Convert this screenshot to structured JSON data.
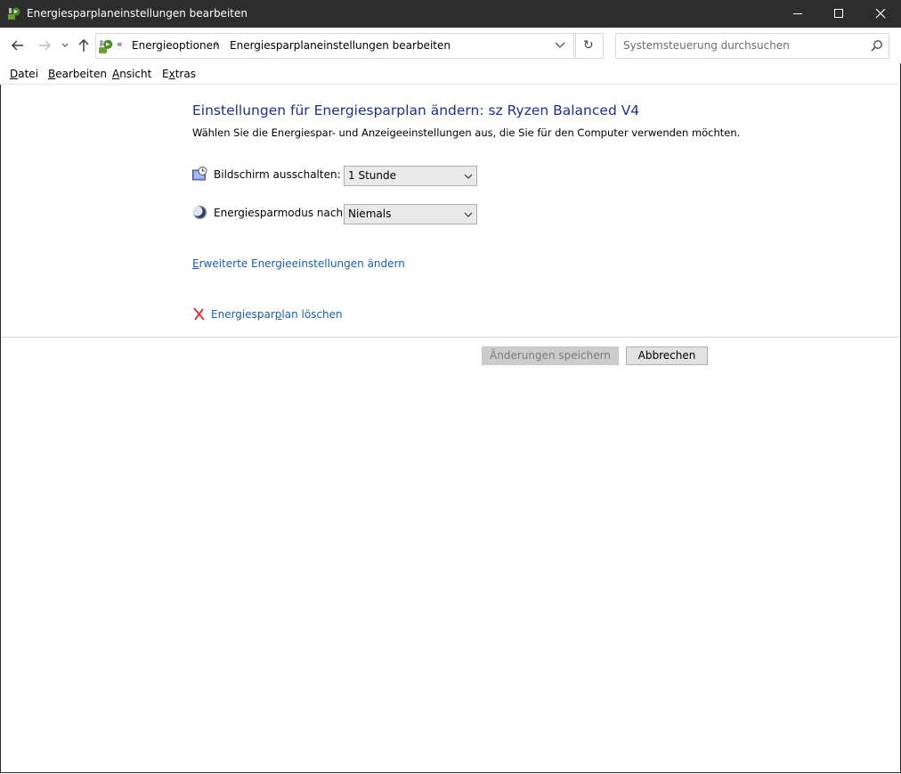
{
  "window": {
    "title": "Energiesparplaneinstellungen bearbeiten"
  },
  "address": {
    "overflow_glyph": "«",
    "crumbs": [
      "Energieoptionen",
      "Energiesparplaneinstellungen bearbeiten"
    ],
    "separator": "›"
  },
  "search": {
    "placeholder": "Systemsteuerung durchsuchen"
  },
  "menu": {
    "file": {
      "hotkey": "D",
      "rest": "atei"
    },
    "edit": {
      "hotkey": "B",
      "rest": "earbeiten"
    },
    "view": {
      "hotkey": "A",
      "rest": "nsicht"
    },
    "extras": {
      "prefix": "E",
      "hotkey": "x",
      "rest": "tras"
    }
  },
  "content": {
    "heading": "Einstellungen für Energiesparplan ändern: sz Ryzen Balanced V4",
    "description": "Wählen Sie die Energiespar- und Anzeigeeinstellungen aus, die Sie für den Computer verwenden möchten.",
    "display_off": {
      "label": "Bildschirm ausschalten:",
      "value": "1 Stunde"
    },
    "sleep": {
      "label": "Energiesparmodus nach:",
      "value": "Niemals"
    },
    "advanced_link": {
      "hotkey": "E",
      "rest": "rweiterte Energieeinstellungen ändern"
    },
    "delete_link": {
      "before": "Energiespar",
      "hotkey": "p",
      "after": "lan löschen"
    }
  },
  "buttons": {
    "save": "Änderungen speichern",
    "cancel": "Abbrechen"
  },
  "colors": {
    "titlebar": "#2d2d2d",
    "heading": "#1e3287",
    "link": "#1a5ea8",
    "delete_icon": "#d23c3c"
  }
}
